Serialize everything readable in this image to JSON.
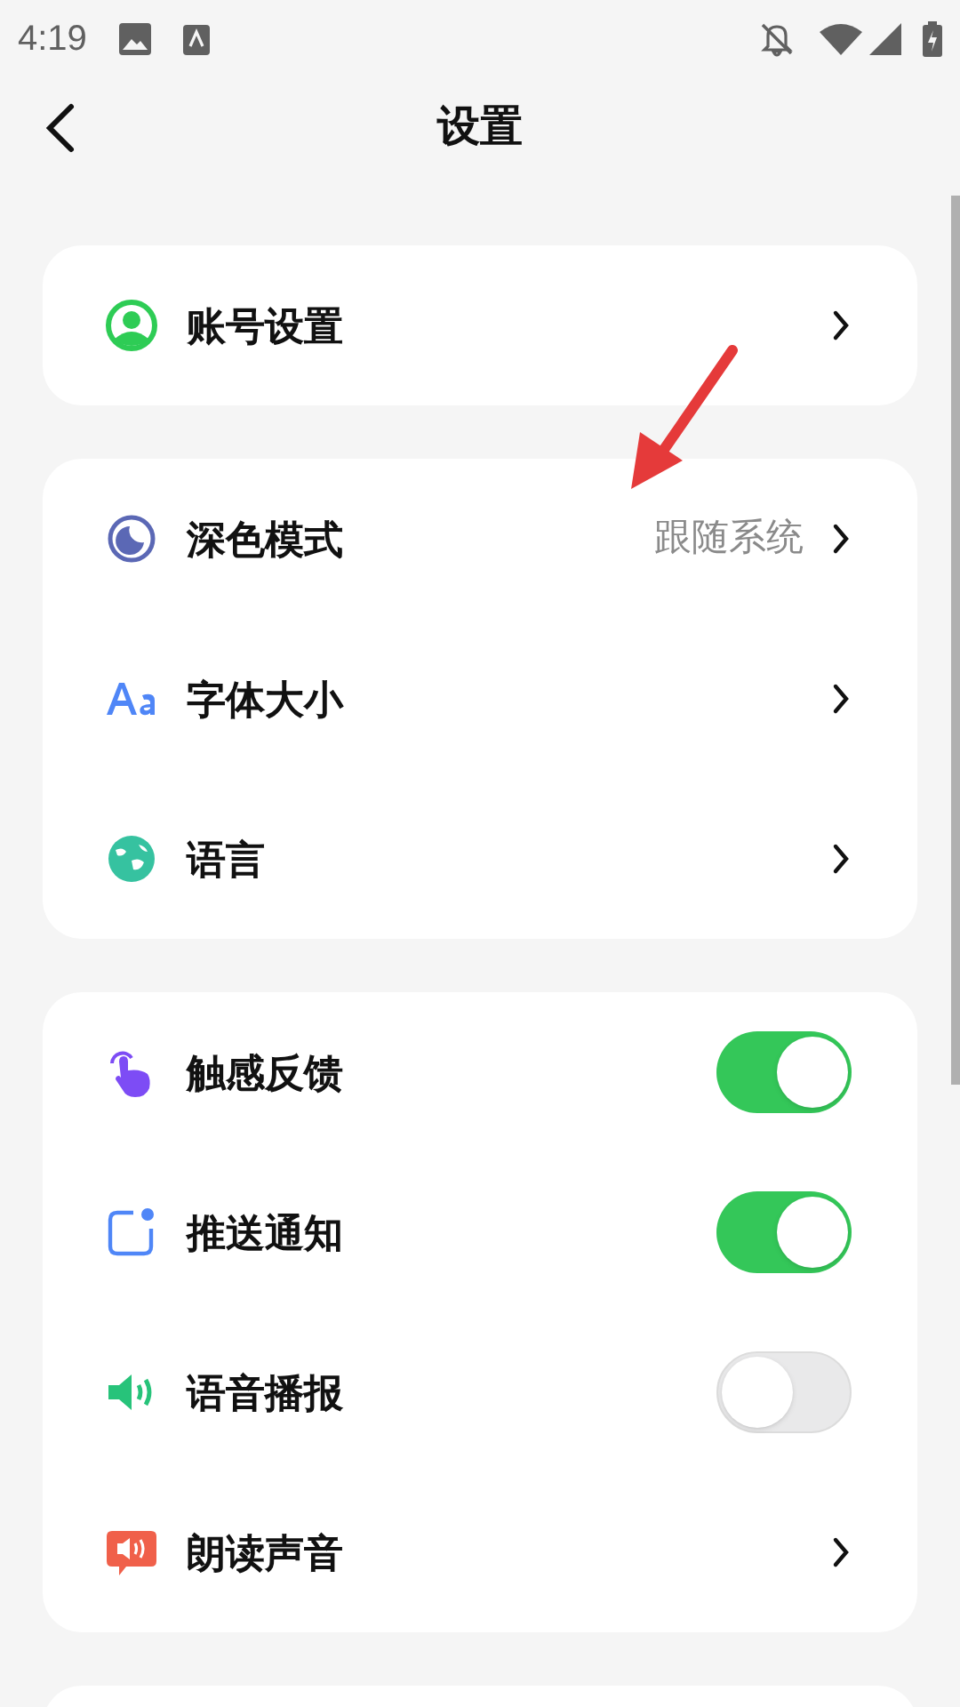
{
  "status_bar": {
    "time": "4:19"
  },
  "header": {
    "title": "设置"
  },
  "groups": [
    {
      "items": [
        {
          "label": "账号设置",
          "kind": "link"
        }
      ]
    },
    {
      "items": [
        {
          "label": "深色模式",
          "kind": "link",
          "value": "跟随系统"
        },
        {
          "label": "字体大小",
          "kind": "link"
        },
        {
          "label": "语言",
          "kind": "link"
        }
      ]
    },
    {
      "items": [
        {
          "label": "触感反馈",
          "kind": "toggle",
          "on": true
        },
        {
          "label": "推送通知",
          "kind": "toggle",
          "on": true
        },
        {
          "label": "语音播报",
          "kind": "toggle",
          "on": false
        },
        {
          "label": "朗读声音",
          "kind": "link"
        }
      ]
    }
  ]
}
